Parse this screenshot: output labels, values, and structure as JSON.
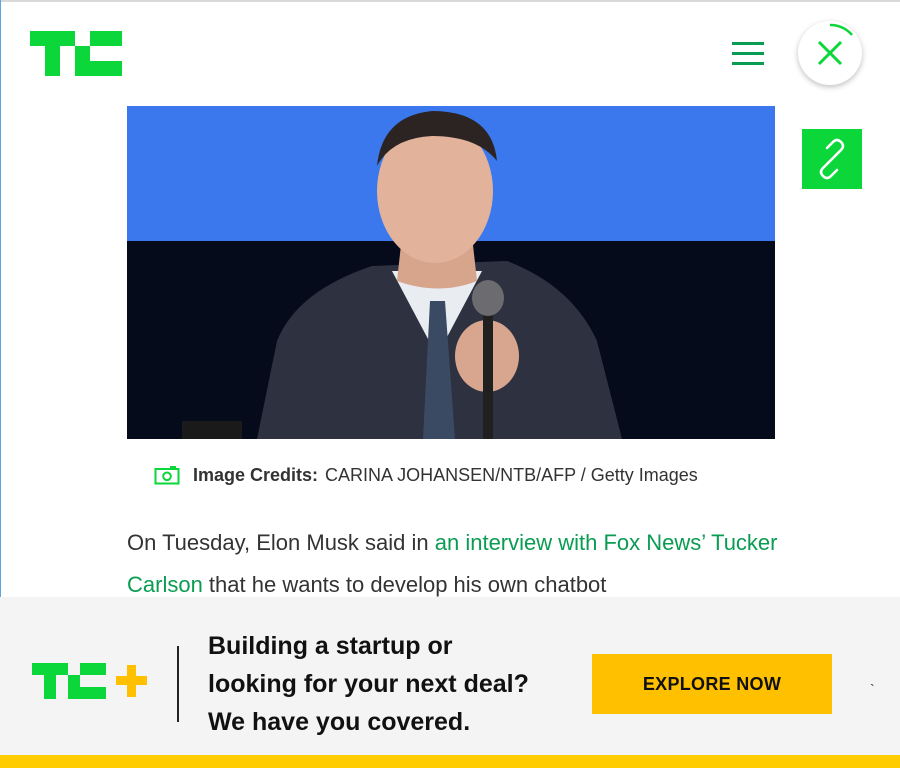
{
  "header": {
    "logo_icon": "techcrunch-tc-logo",
    "menu_icon": "hamburger-menu-icon",
    "close_icon": "close-x-icon",
    "brand_green": "#0bd73a"
  },
  "article": {
    "hero_image_alt": "",
    "share_icon": "link-icon",
    "image_credit": {
      "icon": "camera-icon",
      "label": "Image Credits:",
      "value": "CARINA JOHANSEN/NTB/AFP / Getty Images"
    },
    "paragraph": {
      "prefix": "On Tuesday, Elon Musk said in ",
      "link_text": "an interview with Fox News’ Tucker Carlson",
      "suffix": " that he wants to develop his own chatbot"
    },
    "link_color": "#0a9c52"
  },
  "promo": {
    "logo_icon": "tc-plus-logo",
    "headline_line1": "Building a startup or",
    "headline_line2": "looking for your next deal?",
    "headline_line3": "We have you covered.",
    "cta_label": "EXPLORE NOW",
    "cta_color": "#ffc000",
    "trailing_mark": "`"
  }
}
